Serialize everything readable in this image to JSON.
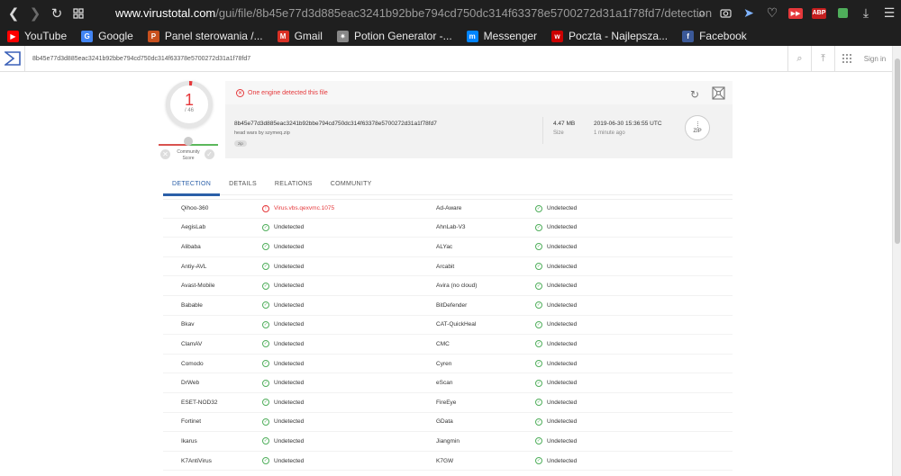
{
  "browser": {
    "url_domain": "www.virustotal.com",
    "url_path": "/gui/file/8b45e77d3d885eac3241b92bbe794cd750dc314f63378e5700272d31a1f78fd7/detection",
    "extensions": [
      "ABP"
    ]
  },
  "bookmarks": [
    {
      "label": "YouTube",
      "color": "#ff0000",
      "glyph": "▶"
    },
    {
      "label": "Google",
      "color": "#4285f4",
      "glyph": "G"
    },
    {
      "label": "Panel sterowania /...",
      "color": "#c8501e",
      "glyph": "P"
    },
    {
      "label": "Gmail",
      "color": "#d93025",
      "glyph": "M"
    },
    {
      "label": "Potion Generator -...",
      "color": "#888888",
      "glyph": "✷"
    },
    {
      "label": "Messenger",
      "color": "#0084ff",
      "glyph": "m"
    },
    {
      "label": "Poczta - Najlepsza...",
      "color": "#cc0000",
      "glyph": "w"
    },
    {
      "label": "Facebook",
      "color": "#3b5998",
      "glyph": "f"
    }
  ],
  "vt": {
    "search_value": "8b45e77d3d885eac3241b92bbe794cd750dc314f63378e5700272d31a1f78fd7",
    "signin": "Sign in",
    "score": {
      "detected": "1",
      "total": "/ 46",
      "community_label": "Community Score"
    },
    "summary": {
      "headline": "One engine detected this file",
      "hash": "8b45e77d3d885eac3241b92bbe794cd750dc314f63378e5700272d31a1f78fd7",
      "filename": "head wars by szymeq.zip",
      "tag": "zip",
      "size": "4.47 MB",
      "size_label": "Size",
      "date": "2019-06-30 15:36:55 UTC",
      "date_ago": "1 minute ago",
      "filetype": "ZIP"
    },
    "tabs": [
      "DETECTION",
      "DETAILS",
      "RELATIONS",
      "COMMUNITY"
    ],
    "rows": [
      {
        "e1": "Qihoo-360",
        "r1": "Virus.vbs.qexvmc.1075",
        "d1": true,
        "e2": "Ad-Aware",
        "r2": "Undetected"
      },
      {
        "e1": "AegisLab",
        "r1": "Undetected",
        "d1": false,
        "e2": "AhnLab-V3",
        "r2": "Undetected"
      },
      {
        "e1": "Alibaba",
        "r1": "Undetected",
        "d1": false,
        "e2": "ALYac",
        "r2": "Undetected"
      },
      {
        "e1": "Antiy-AVL",
        "r1": "Undetected",
        "d1": false,
        "e2": "Arcabit",
        "r2": "Undetected"
      },
      {
        "e1": "Avast-Mobile",
        "r1": "Undetected",
        "d1": false,
        "e2": "Avira (no cloud)",
        "r2": "Undetected"
      },
      {
        "e1": "Babable",
        "r1": "Undetected",
        "d1": false,
        "e2": "BitDefender",
        "r2": "Undetected"
      },
      {
        "e1": "Bkav",
        "r1": "Undetected",
        "d1": false,
        "e2": "CAT-QuickHeal",
        "r2": "Undetected"
      },
      {
        "e1": "ClamAV",
        "r1": "Undetected",
        "d1": false,
        "e2": "CMC",
        "r2": "Undetected"
      },
      {
        "e1": "Comodo",
        "r1": "Undetected",
        "d1": false,
        "e2": "Cyren",
        "r2": "Undetected"
      },
      {
        "e1": "DrWeb",
        "r1": "Undetected",
        "d1": false,
        "e2": "eScan",
        "r2": "Undetected"
      },
      {
        "e1": "ESET-NOD32",
        "r1": "Undetected",
        "d1": false,
        "e2": "FireEye",
        "r2": "Undetected"
      },
      {
        "e1": "Fortinet",
        "r1": "Undetected",
        "d1": false,
        "e2": "GData",
        "r2": "Undetected"
      },
      {
        "e1": "Ikarus",
        "r1": "Undetected",
        "d1": false,
        "e2": "Jiangmin",
        "r2": "Undetected"
      },
      {
        "e1": "K7AntiVirus",
        "r1": "Undetected",
        "d1": false,
        "e2": "K7GW",
        "r2": "Undetected"
      }
    ],
    "colors": {
      "danger": "#e5383b",
      "ok": "#4fae5b",
      "accent": "#2a5fa8"
    }
  }
}
